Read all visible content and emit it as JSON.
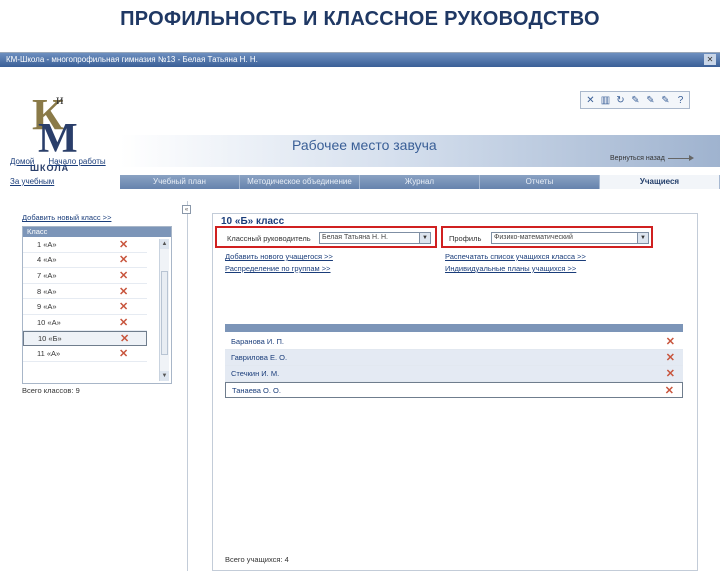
{
  "slide_title": "ПРОФИЛЬНОСТЬ И КЛАССНОЕ РУКОВОДСТВО",
  "window": {
    "title": "КМ-Школа - многопрофильная гимназия №13 - Белая Татьяна Н. Н."
  },
  "logo": {
    "k": "К",
    "i": "и",
    "m": "М",
    "school": "ШКОЛА"
  },
  "toolbar_icons": [
    "close-icon",
    "save-icon",
    "refresh-icon",
    "edit-icon",
    "edit-icon",
    "edit-icon",
    "help-icon"
  ],
  "banner_title": "Рабочее место завуча",
  "nav": {
    "home": "Домой",
    "work_start": "Начало работы"
  },
  "back_link": "Вернуться назад",
  "subnav": "За учебным",
  "tabs": [
    "Учебный план",
    "Методическое объединение",
    "Журнал",
    "Отчеты",
    "Учащиеся"
  ],
  "left": {
    "add_class": "Добавить новый класс >>",
    "header": "Класс",
    "classes": [
      "1 «А»",
      "4 «А»",
      "7 «А»",
      "8 «А»",
      "9 «А»",
      "10 «А»",
      "10 «Б»",
      "11 «А»"
    ],
    "total": "Всего классов: 9"
  },
  "right": {
    "class_title": "10 «Б» класс",
    "teacher_label": "Классный руководитель",
    "teacher_value": "Белая Татьяна Н. Н.",
    "profile_label": "Профиль",
    "profile_value": "Физико-математический",
    "add_student": "Добавить нового учащегося >>",
    "distribution": "Распределение по группам >>",
    "print_list": "Распечатать список учащихся класса >>",
    "individual_plans": "Индивидуальные планы учащихся >>",
    "students": [
      "Баранова И. П.",
      "Гаврилова Е. О.",
      "Стечкин И. М.",
      "Танаева О. О."
    ],
    "total": "Всего учащихся: 4"
  }
}
